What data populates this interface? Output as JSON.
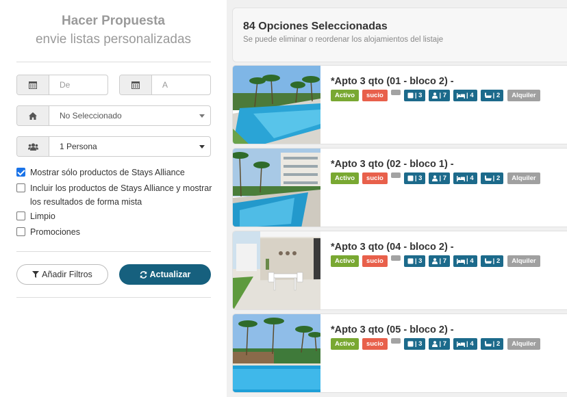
{
  "sidebar": {
    "title": "Hacer Propuesta",
    "subtitle": "envie listas personalizadas",
    "date_from_placeholder": "De",
    "date_to_placeholder": "A",
    "property_select": "No Seleccionado",
    "guests_select": "1 Persona",
    "checkboxes": [
      {
        "label": "Mostrar sólo productos de Stays Alliance",
        "checked": true
      },
      {
        "label": "Incluir los productos de Stays Alliance y mostrar",
        "label_line2": "los resultados de forma mista",
        "checked": false
      },
      {
        "label": "Limpio",
        "checked": false
      },
      {
        "label": "Promociones",
        "checked": false
      }
    ],
    "add_filters_label": "Añadir Filtros",
    "update_label": "Actualizar"
  },
  "results": {
    "heading": "84 Opciones Seleccionadas",
    "subheading": "Se puede eliminar o reordenar los alojamientos del listaje",
    "listings": [
      {
        "name": "*Apto 3 qto (01 - bloco 2) -",
        "status": "Activo",
        "clean": "sucio",
        "rooms": "| 3",
        "guests": "| 7",
        "beds": "| 4",
        "baths": "| 2",
        "type": "Alquiler"
      },
      {
        "name": "*Apto 3 qto (02 - bloco 1) -",
        "status": "Activo",
        "clean": "sucio",
        "rooms": "| 3",
        "guests": "| 7",
        "beds": "| 4",
        "baths": "| 2",
        "type": "Alquiler"
      },
      {
        "name": "*Apto 3 qto (04 - bloco 2) -",
        "status": "Activo",
        "clean": "sucio",
        "rooms": "| 3",
        "guests": "| 7",
        "beds": "| 4",
        "baths": "| 2",
        "type": "Alquiler"
      },
      {
        "name": "*Apto 3 qto (05 - bloco 2) -",
        "status": "Activo",
        "clean": "sucio",
        "rooms": "| 3",
        "guests": "| 7",
        "beds": "| 4",
        "baths": "| 2",
        "type": "Alquiler"
      }
    ]
  },
  "colors": {
    "primary": "#16607e",
    "status_green": "#79a832",
    "status_red": "#e8604b",
    "info_blue": "#1c6a8b",
    "neutral_gray": "#a0a0a0"
  },
  "icons": [
    "calendar-icon",
    "home-icon",
    "users-icon",
    "filter-icon",
    "refresh-icon",
    "door-icon",
    "person-icon",
    "bed-icon",
    "bath-icon"
  ]
}
